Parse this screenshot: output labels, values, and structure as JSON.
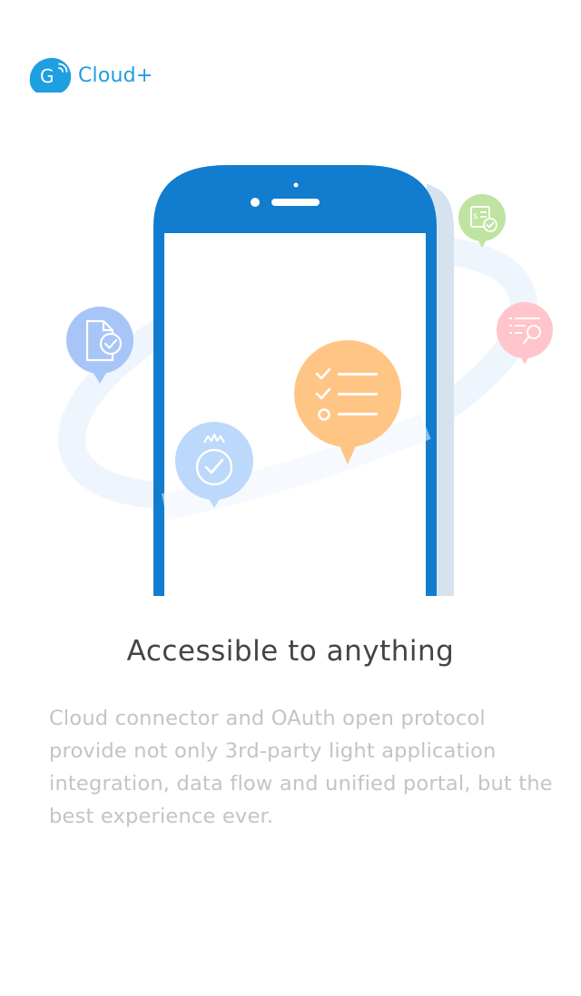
{
  "brand": {
    "name": "Cloud+",
    "logo_icon": "cloud-g-logo-icon",
    "color": "#1e9fe0"
  },
  "hero": {
    "phone_color": "#127ccf",
    "bubbles": [
      {
        "icon": "document-check-icon",
        "color": "#a8c5f7"
      },
      {
        "icon": "medal-check-icon",
        "color": "#bcd8fb"
      },
      {
        "icon": "checklist-icon",
        "color": "#ffc585"
      },
      {
        "icon": "invoice-check-icon",
        "color": "#bfe3a0"
      },
      {
        "icon": "search-list-icon",
        "color": "#ffc4cc"
      }
    ]
  },
  "content": {
    "title": "Accessible to anything",
    "description": "Cloud connector and OAuth open protocol provide not only 3rd-party light application integration, data flow and unified portal, but the best experience ever."
  }
}
